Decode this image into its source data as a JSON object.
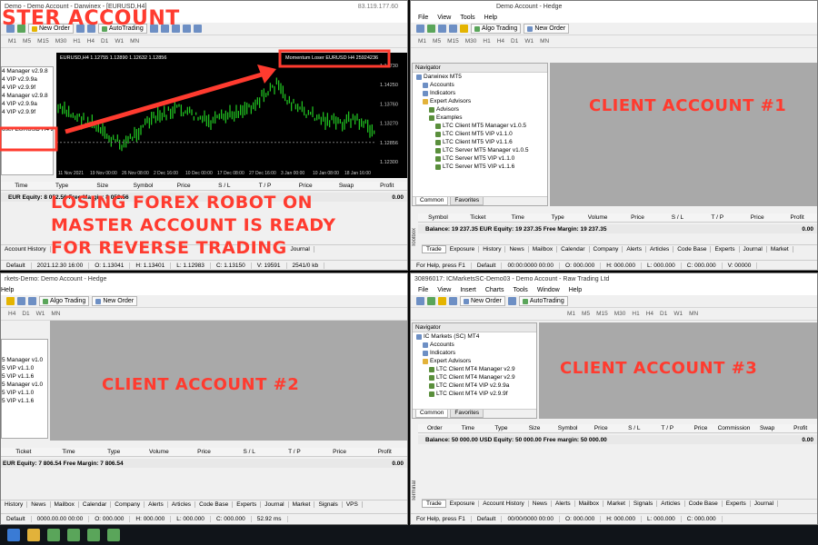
{
  "master": {
    "title": "Demo - Demo Account - Darwinex - [EURUSD,H4]",
    "ip": "83.119.177.60",
    "timeframes": [
      "M1",
      "M5",
      "M15",
      "M30",
      "H1",
      "H4",
      "D1",
      "W1",
      "MN"
    ],
    "autotrading": "AutoTrading",
    "new_order": "New Order",
    "nav_items": [
      "4 Manager v2.9.8",
      "4 VIP v2.9.9a",
      "4 VIP v2.9.9f",
      "4 Manager v2.9.8",
      "4 VIP v2.9.9a",
      "4 VIP v2.9.9f",
      "oser EURUSD H4 2"
    ],
    "chart_header": "EURUSD,H4  1.12755 1.12890 1.12632 1.12856",
    "indicator_label": "Momentum Loser EURUSD H4 25924236",
    "price_ticks": [
      "1.14730",
      "1.14250",
      "1.13760",
      "1.13270",
      "1.12856",
      "1.12300"
    ],
    "date_ticks": [
      "11 Nov 2021",
      "19 Nov 00:00",
      "26 Nov 08:00",
      "2 Dec 16:00",
      "10 Dec 00:00",
      "17 Dec 08:00",
      "27 Dec 16:00",
      "3 Jan 00:00",
      "10 Jan 08:00",
      "18 Jan 16:00"
    ],
    "trade_cols": [
      "Time",
      "Type",
      "Size",
      "Symbol",
      "Price",
      "S / L",
      "T / P",
      "Price",
      "Swap",
      "Profit"
    ],
    "balance": "EUR  Equity: 8 052.56  Free Margin: 8 052.56",
    "balance_right": "0.00",
    "tab_history": "Account History",
    "tab_journal": "Journal",
    "status": [
      "Default",
      "2021.12.30 16:00",
      "O: 1.13041",
      "H: 1.13401",
      "L: 1.12983",
      "C: 1.13150",
      "V: 19591",
      "2541/0 kb"
    ]
  },
  "overlay": {
    "master_label": "STER ACCOUNT",
    "losing_1": "LOSING FOREX ROBOT ON",
    "losing_2": "MASTER ACCOUNT IS READY",
    "losing_3": "FOR REVERSE TRADING",
    "client1": "CLIENT ACCOUNT #1",
    "client2": "CLIENT ACCOUNT #2",
    "client3": "CLIENT ACCOUNT #3"
  },
  "client1": {
    "title": "Demo Account - Hedge",
    "menu": [
      "File",
      "View",
      "Tools",
      "Help"
    ],
    "algo": "Algo Trading",
    "new_order": "New Order",
    "timeframes": [
      "M1",
      "M5",
      "M15",
      "M30",
      "H1",
      "H4",
      "D1",
      "W1",
      "MN"
    ],
    "nav_title": "Navigator",
    "nav": [
      "Darwinex MT5",
      "Accounts",
      "Indicators",
      "Expert Advisors",
      "Advisors",
      "Examples",
      "LTC Client MT5 Manager v1.0.5",
      "LTC Client MT5 VIP v1.1.0",
      "LTC Client MT5 VIP v1.1.6",
      "LTC Server MT5 Manager v1.0.5",
      "LTC Server MT5 VIP v1.1.0",
      "LTC Server MT5 VIP v1.1.6"
    ],
    "nav_tabs": [
      "Common",
      "Favorites"
    ],
    "trade_cols": [
      "Symbol",
      "Ticket",
      "Time",
      "Type",
      "Volume",
      "Price",
      "S / L",
      "T / P",
      "Price",
      "Profit"
    ],
    "balance": "Balance: 19 237.35 EUR  Equity: 19 237.35  Free Margin: 19 237.35",
    "balance_right": "0.00",
    "tabs": [
      "Trade",
      "Exposure",
      "History",
      "News",
      "Mailbox",
      "Calendar",
      "Company",
      "Alerts",
      "Articles",
      "Code Base",
      "Experts",
      "Journal",
      "Market"
    ],
    "status": [
      "For Help, press F1",
      "Default",
      "00:00:0000 00:00",
      "O: 000.000",
      "H: 000.000",
      "L: 000.000",
      "C: 000.000",
      "V: 00000"
    ],
    "side": "Toolbox"
  },
  "client2": {
    "title": "rkets-Demo: Demo Account - Hedge",
    "menu": [
      "Help"
    ],
    "algo": "Algo Trading",
    "new_order": "New Order",
    "timeframes": [
      "H4",
      "D1",
      "W1",
      "MN"
    ],
    "nav": [
      "5 Manager v1.0",
      "5 VIP v1.1.0",
      "5 VIP v1.1.6",
      "5 Manager v1.0",
      "5 VIP v1.1.0",
      "5 VIP v1.1.6"
    ],
    "trade_cols": [
      "Ticket",
      "Time",
      "Type",
      "Volume",
      "Price",
      "S / L",
      "T / P",
      "Price",
      "Profit"
    ],
    "balance": "EUR  Equity: 7 806.54  Free Margin: 7 806.54",
    "balance_right": "0.00",
    "tabs": [
      "History",
      "News",
      "Mailbox",
      "Calendar",
      "Company",
      "Alerts",
      "Articles",
      "Code Base",
      "Experts",
      "Journal",
      "Market",
      "Signals",
      "VPS"
    ],
    "status": [
      "Default",
      "0000.00.00 00:00",
      "O: 000.000",
      "H: 000.000",
      "L: 000.000",
      "C: 000.000",
      "52.92 ms"
    ]
  },
  "client3": {
    "title": "30896017: ICMarketsSC-Demo03 - Demo Account - Raw Trading Ltd",
    "menu": [
      "File",
      "View",
      "Insert",
      "Charts",
      "Tools",
      "Window",
      "Help"
    ],
    "new_order": "New Order",
    "autotrading": "AutoTrading",
    "timeframes": [
      "M1",
      "M5",
      "M15",
      "M30",
      "H1",
      "H4",
      "D1",
      "W1",
      "MN"
    ],
    "nav_title": "Navigator",
    "nav": [
      "IC Markets (SC) MT4",
      "Accounts",
      "Indicators",
      "Expert Advisors",
      "LTC Client MT4 Manager v2.9",
      "LTC Client MT4 Manager v2.9",
      "LTC Client MT4 VIP v2.9.9a",
      "LTC Client MT4 VIP v2.9.9f"
    ],
    "nav_tabs": [
      "Common",
      "Favorites"
    ],
    "trade_cols": [
      "Order",
      "Time",
      "Type",
      "Size",
      "Symbol",
      "Price",
      "S / L",
      "T / P",
      "Price",
      "Commission",
      "Swap",
      "Profit"
    ],
    "balance": "Balance: 50 000.00 USD  Equity: 50 000.00  Free margin: 50 000.00",
    "balance_right": "0.00",
    "tabs": [
      "Trade",
      "Exposure",
      "Account History",
      "News",
      "Alerts",
      "Mailbox",
      "Market",
      "Signals",
      "Articles",
      "Code Base",
      "Experts",
      "Journal"
    ],
    "status": [
      "For Help, press F1",
      "Default",
      "00/00/0000 00:00",
      "O: 000.000",
      "H: 000.000",
      "L: 000.000",
      "C: 000.000"
    ],
    "side": "Terminal"
  },
  "colors": {
    "overlay": "#ff3b2f",
    "candle": "#22cc22",
    "chart_bg": "#000000",
    "window_bg": "#f0f0f0",
    "workspace": "#a9a9a9"
  }
}
